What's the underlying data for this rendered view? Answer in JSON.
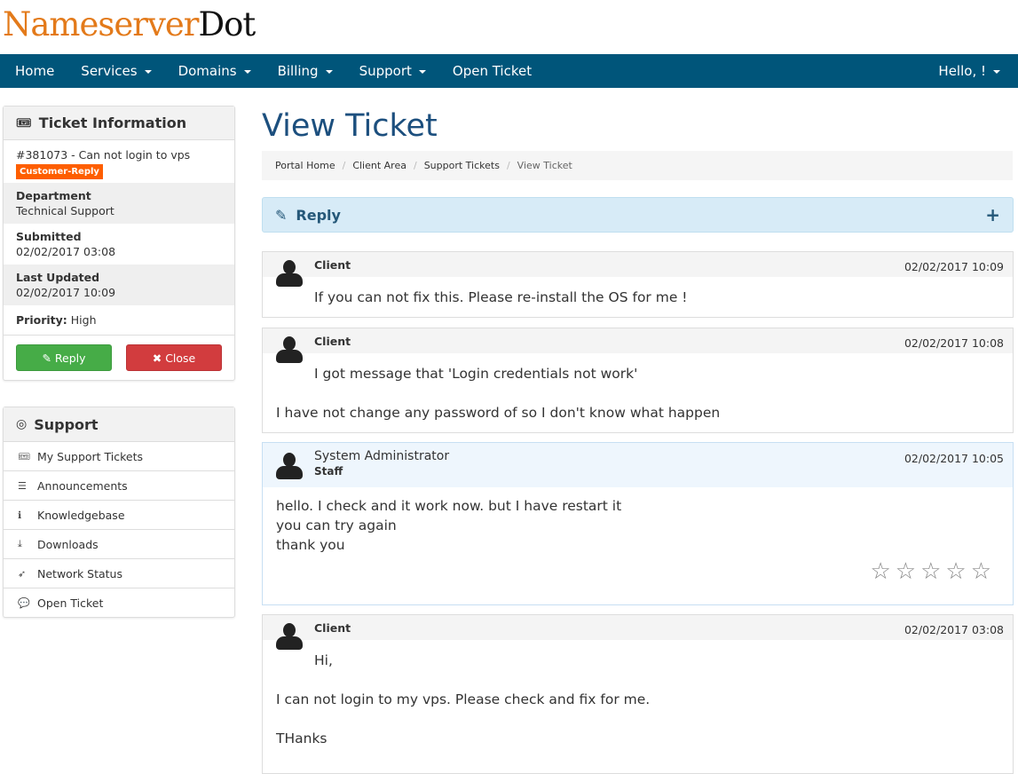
{
  "logo": {
    "part1": "Nameserver",
    "part2": "Dot"
  },
  "nav": {
    "items": [
      "Home",
      "Services",
      "Domains",
      "Billing",
      "Support",
      "Open Ticket"
    ],
    "user": "Hello, !"
  },
  "ticket_info": {
    "heading": "Ticket Information",
    "subject": "#381073 - Can not login to vps",
    "status": "Customer-Reply",
    "department_label": "Department",
    "department": "Technical Support",
    "submitted_label": "Submitted",
    "submitted": "02/02/2017 03:08",
    "updated_label": "Last Updated",
    "updated": "02/02/2017 10:09",
    "priority_label": "Priority:",
    "priority": "High",
    "reply_btn": "Reply",
    "close_btn": "Close"
  },
  "support": {
    "heading": "Support",
    "items": [
      "My Support Tickets",
      "Announcements",
      "Knowledgebase",
      "Downloads",
      "Network Status",
      "Open Ticket"
    ]
  },
  "page_title": "View Ticket",
  "breadcrumb": [
    "Portal Home",
    "Client Area",
    "Support Tickets",
    "View Ticket"
  ],
  "reply_panel": {
    "label": "Reply"
  },
  "messages": [
    {
      "author": "Client",
      "date": "02/02/2017 10:09",
      "lines": [
        "If you can not fix this. Please re-install the OS for me !"
      ]
    },
    {
      "author": "Client",
      "date": "02/02/2017 10:08",
      "lines": [
        "I got message that 'Login credentials not work'",
        "I have not change any password of so I don't know what happen"
      ]
    },
    {
      "author": "System Administrator",
      "role": "Staff",
      "date": "02/02/2017 10:05",
      "lines": [
        "hello. I check and it work now. but I have restart it",
        "you can try again",
        "thank you"
      ],
      "rating": 0
    },
    {
      "author": "Client",
      "date": "02/02/2017 03:08",
      "lines": [
        "Hi,",
        "I can not login to my vps. Please check and fix for me.",
        "THanks"
      ]
    }
  ]
}
